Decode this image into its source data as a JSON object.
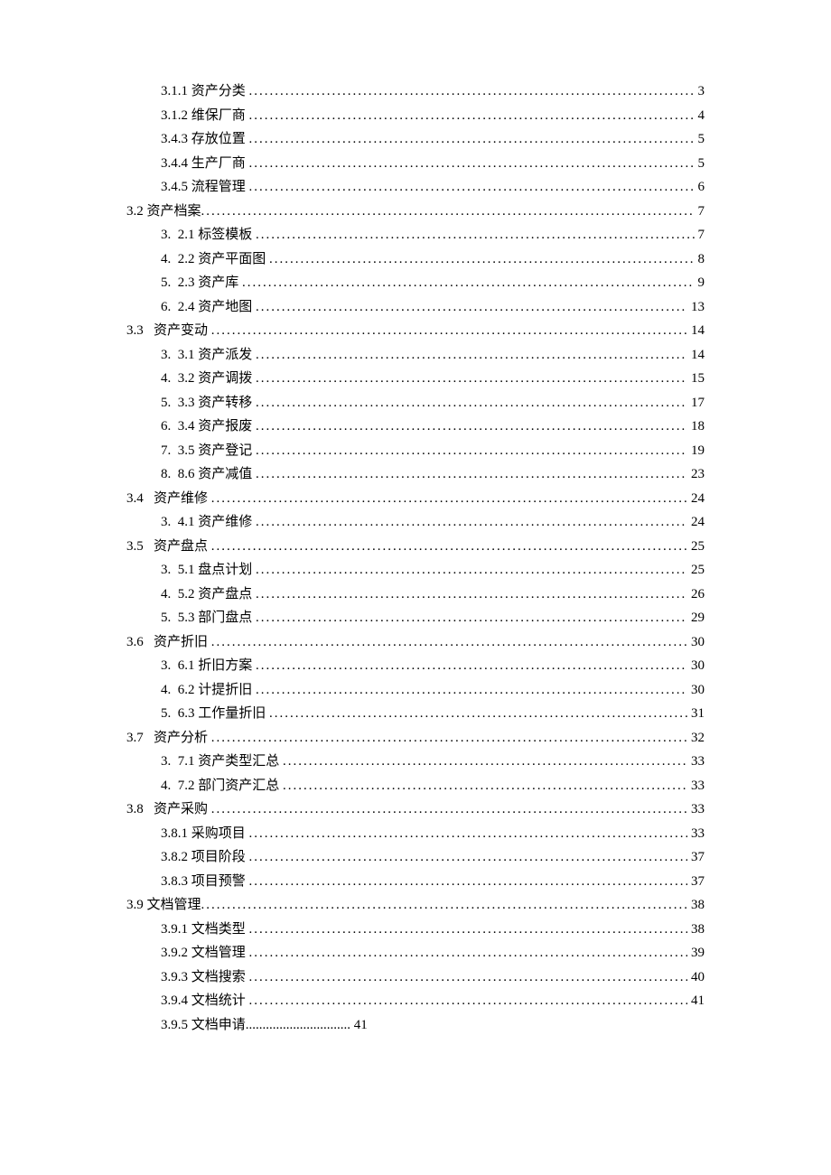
{
  "toc": [
    {
      "indent": 2,
      "label": "3.1.1 资产分类 ",
      "page": "3"
    },
    {
      "indent": 2,
      "label": "3.1.2 维保厂商 ",
      "page": "4"
    },
    {
      "indent": 2,
      "label": "3.4.3 存放位置 ",
      "page": "5"
    },
    {
      "indent": 2,
      "label": "3.4.4 生产厂商 ",
      "page": "5"
    },
    {
      "indent": 2,
      "label": "3.4.5 流程管理 ",
      "page": "6"
    },
    {
      "indent": 1,
      "label": "3.2 资产档案",
      "page": "7"
    },
    {
      "indent": 2,
      "label": "3.  2.1 标签模板 ",
      "page": "7"
    },
    {
      "indent": 2,
      "label": "4.  2.2 资产平面图 ",
      "page": "8"
    },
    {
      "indent": 2,
      "label": "5.  2.3 资产库 ",
      "page": "9"
    },
    {
      "indent": 2,
      "label": "6.  2.4 资产地图 ",
      "page": "13"
    },
    {
      "indent": 1,
      "label": "3.3   资产变动 ",
      "page": "14"
    },
    {
      "indent": 2,
      "label": "3.  3.1 资产派发 ",
      "page": "14"
    },
    {
      "indent": 2,
      "label": "4.  3.2 资产调拨 ",
      "page": "15"
    },
    {
      "indent": 2,
      "label": "5.  3.3 资产转移 ",
      "page": "17"
    },
    {
      "indent": 2,
      "label": "6.  3.4 资产报废 ",
      "page": "18"
    },
    {
      "indent": 2,
      "label": "7.  3.5 资产登记 ",
      "page": "19"
    },
    {
      "indent": 2,
      "label": "8.  8.6 资产减值 ",
      "page": "23"
    },
    {
      "indent": 1,
      "label": "3.4   资产维修 ",
      "page": "24"
    },
    {
      "indent": 2,
      "label": "3.  4.1 资产维修 ",
      "page": "24"
    },
    {
      "indent": 1,
      "label": "3.5   资产盘点 ",
      "page": "25"
    },
    {
      "indent": 2,
      "label": "3.  5.1 盘点计划 ",
      "page": "25"
    },
    {
      "indent": 2,
      "label": "4.  5.2 资产盘点 ",
      "page": "26"
    },
    {
      "indent": 2,
      "label": "5.  5.3 部门盘点 ",
      "page": "29"
    },
    {
      "indent": 1,
      "label": "3.6   资产折旧 ",
      "page": "30"
    },
    {
      "indent": 2,
      "label": "3.  6.1 折旧方案 ",
      "page": "30"
    },
    {
      "indent": 2,
      "label": "4.  6.2 计提折旧 ",
      "page": "30"
    },
    {
      "indent": 2,
      "label": "5.  6.3 工作量折旧 ",
      "page": "31"
    },
    {
      "indent": 1,
      "label": "3.7   资产分析 ",
      "page": "32"
    },
    {
      "indent": 2,
      "label": "3.  7.1 资产类型汇总 ",
      "page": "33"
    },
    {
      "indent": 2,
      "label": "4.  7.2 部门资产汇总 ",
      "page": "33"
    },
    {
      "indent": 1,
      "label": "3.8   资产采购 ",
      "page": "33"
    },
    {
      "indent": 2,
      "label": "3.8.1 采购项目 ",
      "page": "33"
    },
    {
      "indent": 2,
      "label": "3.8.2 项目阶段 ",
      "page": "37"
    },
    {
      "indent": 2,
      "label": "3.8.3 项目预警 ",
      "page": "37"
    },
    {
      "indent": 1,
      "label": "3.9 文档管理",
      "page": "38"
    },
    {
      "indent": 2,
      "label": "3.9.1 文档类型 ",
      "page": "38"
    },
    {
      "indent": 2,
      "label": "3.9.2 文档管理 ",
      "page": "39"
    },
    {
      "indent": 2,
      "label": "3.9.3 文档搜索 ",
      "page": "40"
    },
    {
      "indent": 2,
      "label": "3.9.4 文档统计 ",
      "page": "41"
    },
    {
      "indent": 2,
      "label": "3.9.5 文档申请............................... 41",
      "page": "",
      "nodots": true
    }
  ]
}
